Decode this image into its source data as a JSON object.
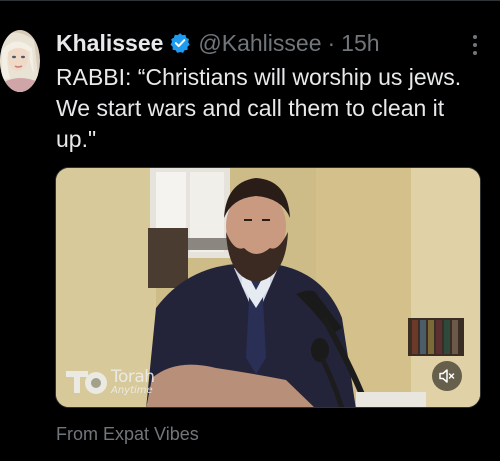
{
  "tweet": {
    "display_name": "Khalissee",
    "verified_icon": "verified-badge-icon",
    "handle": "@Kahlissee",
    "separator": "·",
    "timestamp": "15h",
    "more_icon": "more-options-icon",
    "text": "RABBI: “Christians will worship us jews. We start wars and call them to clean it up.\"",
    "media": {
      "watermark_title": "Torah",
      "watermark_subtitle": "Anytime",
      "mute_icon": "volume-muted-icon"
    },
    "attribution": "From Expat Vibes"
  },
  "colors": {
    "background": "#000000",
    "primary_text": "#e7e9ea",
    "secondary_text": "#71767b",
    "verified": "#1d9bf0",
    "divider": "#2f3336"
  }
}
